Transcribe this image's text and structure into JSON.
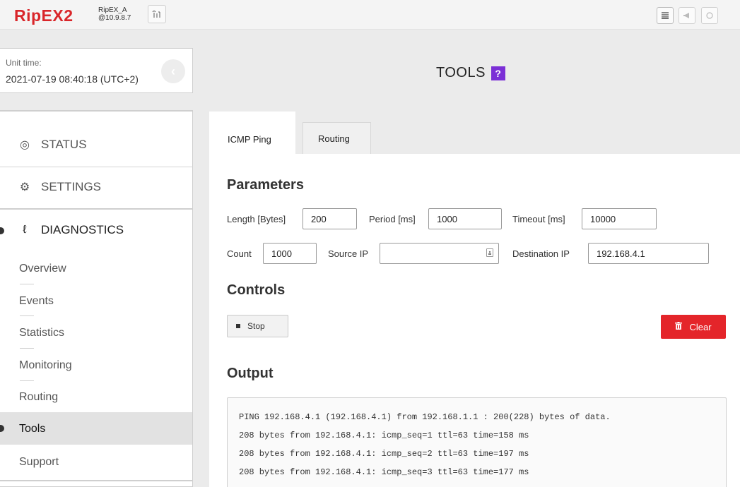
{
  "header": {
    "logo_text": "RipEX2",
    "unit_name": "RipEX_A",
    "unit_ip": "@10.9.8.7",
    "radio_icon": "radio-signal-icon",
    "right_buttons": [
      {
        "icon": "list-icon",
        "glyph": "≣"
      },
      {
        "icon": "megaphone-icon",
        "glyph": "◀"
      },
      {
        "icon": "refresh-icon",
        "glyph": "↻"
      }
    ]
  },
  "unit_time": {
    "label": "Unit time:",
    "value": "2021-07-19 08:40:18 (UTC+2)",
    "collapse_glyph": "‹"
  },
  "page": {
    "title": "TOOLS",
    "help_label": "?"
  },
  "sidebar": {
    "status": {
      "label": "STATUS",
      "icon_glyph": "◎"
    },
    "settings": {
      "label": "SETTINGS",
      "icon_glyph": "⚙"
    },
    "diagnostics": {
      "label": "DIAGNOSTICS",
      "icon_glyph": "ℓ"
    },
    "items": [
      {
        "label": "Overview"
      },
      {
        "label": "Events"
      },
      {
        "label": "Statistics"
      },
      {
        "label": "Monitoring"
      },
      {
        "label": "Routing"
      },
      {
        "label": "Tools"
      },
      {
        "label": "Support"
      }
    ]
  },
  "tabs": [
    {
      "label": "ICMP Ping",
      "active": true
    },
    {
      "label": "Routing",
      "active": false
    }
  ],
  "parameters": {
    "heading": "Parameters",
    "length": {
      "label": "Length [Bytes]",
      "value": "200"
    },
    "period": {
      "label": "Period [ms]",
      "value": "1000"
    },
    "timeout": {
      "label": "Timeout [ms]",
      "value": "10000"
    },
    "count": {
      "label": "Count",
      "value": "1000"
    },
    "source_ip": {
      "label": "Source IP",
      "value": ""
    },
    "destination_ip": {
      "label": "Destination IP",
      "value": "192.168.4.1"
    }
  },
  "controls": {
    "heading": "Controls",
    "stop_label": "Stop",
    "clear_label": "Clear",
    "clear_color": "#e4252a"
  },
  "output": {
    "heading": "Output",
    "lines": [
      "PING 192.168.4.1 (192.168.4.1) from 192.168.1.1 : 200(228) bytes of data.",
      "208 bytes from 192.168.4.1: icmp_seq=1 ttl=63 time=158 ms",
      "208 bytes from 192.168.4.1: icmp_seq=2 ttl=63 time=197 ms",
      "208 bytes from 192.168.4.1: icmp_seq=3 ttl=63 time=177 ms"
    ]
  },
  "colors": {
    "brand_red": "#d9262a",
    "help_purple": "#7b2fd6"
  }
}
